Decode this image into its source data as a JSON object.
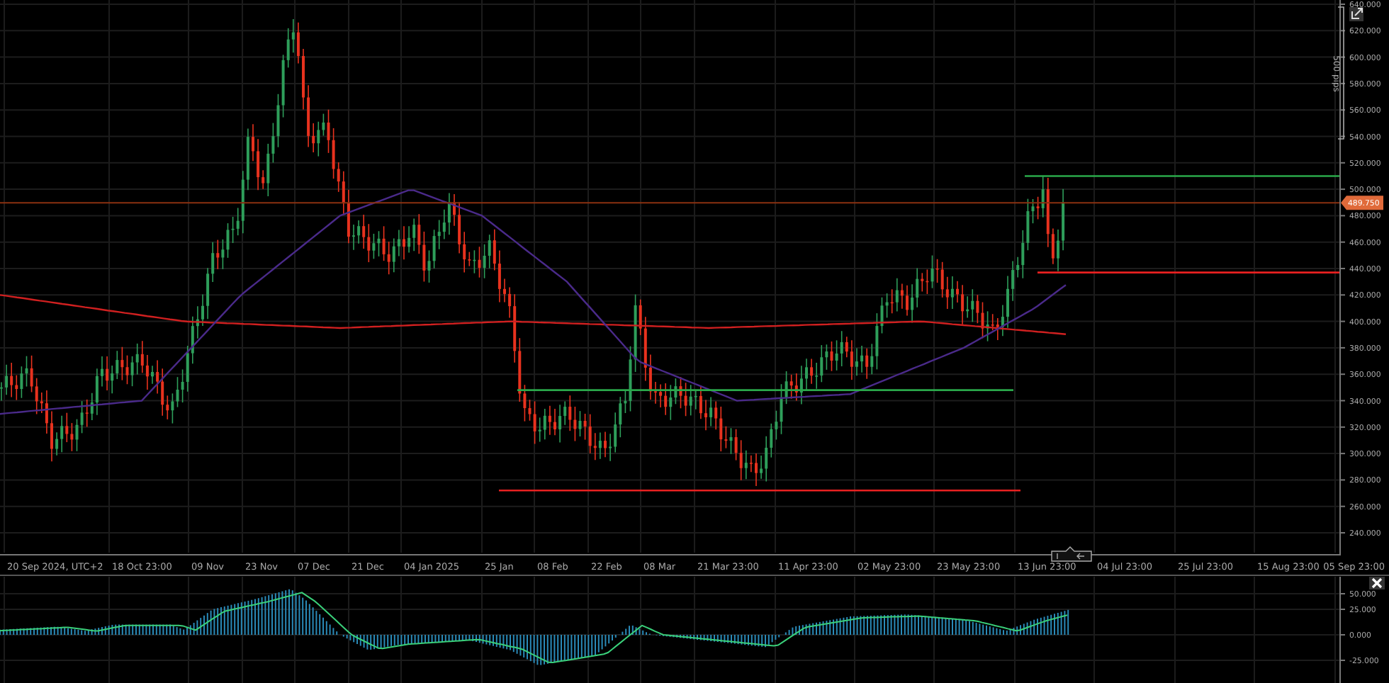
{
  "price_chart": {
    "y_labels": [
      "640.000",
      "620.000",
      "600.000",
      "580.000",
      "560.000",
      "540.000",
      "520.000",
      "500.000",
      "480.000",
      "460.000",
      "440.000",
      "420.000",
      "400.000",
      "380.000",
      "360.000",
      "340.000",
      "320.000",
      "300.000",
      "280.000",
      "260.000",
      "240.000"
    ],
    "x_labels": [
      "20 Sep 2024, UTC+2",
      "18 Oct 23:00",
      "09 Nov",
      "23 Nov",
      "07 Dec",
      "21 Dec",
      "04 Jan 2025",
      "25 Jan",
      "08 Feb",
      "22 Feb",
      "08 Mar",
      "21 Mar 23:00",
      "11 Apr 23:00",
      "02 May 23:00",
      "23 May 23:00",
      "13 Jun 23:00",
      "04 Jul 23:00",
      "25 Jul 23:00",
      "15 Aug 23:00",
      "05 Sep 23:00"
    ],
    "current_price": "489.750",
    "range_ruler": "500 pips"
  },
  "indicator": {
    "y_labels": [
      "50.000",
      "25.000",
      "0.000",
      "-25.000"
    ]
  }
}
